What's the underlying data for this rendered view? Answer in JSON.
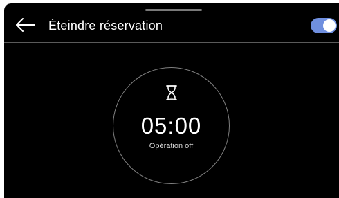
{
  "header": {
    "title": "Éteindre réservation",
    "back_icon": "arrow-left-icon",
    "toggle": {
      "state": "on",
      "color": "#6f8fdf"
    }
  },
  "timer": {
    "icon": "hourglass-icon",
    "time": "05:00",
    "status": "Opération off"
  }
}
